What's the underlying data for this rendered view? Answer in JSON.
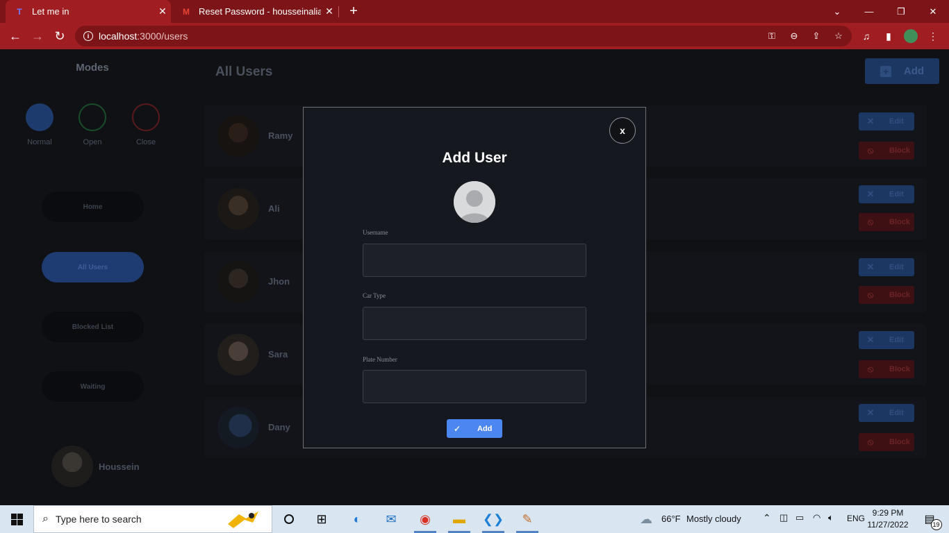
{
  "browser": {
    "tabs": [
      {
        "title": "Let me in",
        "active": true
      },
      {
        "title": "Reset Password - housseinalialdr",
        "active": false
      }
    ],
    "url_host": "localhost",
    "url_path": ":3000/users"
  },
  "sidebar": {
    "title": "Modes",
    "modes": [
      {
        "label": "Normal",
        "color": "#1e3b6e"
      },
      {
        "label": "Open",
        "color": "#1a4d2a"
      },
      {
        "label": "Close",
        "color": "#5a1a1c"
      }
    ],
    "nav": [
      {
        "label": "Home",
        "active": false
      },
      {
        "label": "All Users",
        "active": true
      },
      {
        "label": "Blocked List",
        "active": false
      },
      {
        "label": "Waiting",
        "active": false
      }
    ],
    "profile_name": "Houssein"
  },
  "main": {
    "title": "All Users",
    "add_label": "Add",
    "users": [
      {
        "name": "Ramy"
      },
      {
        "name": "Ali"
      },
      {
        "name": "Jhon"
      },
      {
        "name": "Sara"
      },
      {
        "name": "Dany"
      }
    ],
    "edit_label": "Edit",
    "block_label": "Block"
  },
  "modal": {
    "close_label": "x",
    "title": "Add User",
    "fields": [
      {
        "label": "Username",
        "value": ""
      },
      {
        "label": "Car Type",
        "value": ""
      },
      {
        "label": "Plate Number",
        "value": ""
      }
    ],
    "submit_label": "Add"
  },
  "taskbar": {
    "search_placeholder": "Type here to search",
    "weather_temp": "66°F",
    "weather_desc": "Mostly cloudy",
    "lang": "ENG",
    "time": "9:29 PM",
    "date": "11/27/2022",
    "notif_count": "19"
  },
  "colors": {
    "accent": "#4c86f0",
    "chrome": "#a01d22",
    "danger": "#3d1113"
  }
}
